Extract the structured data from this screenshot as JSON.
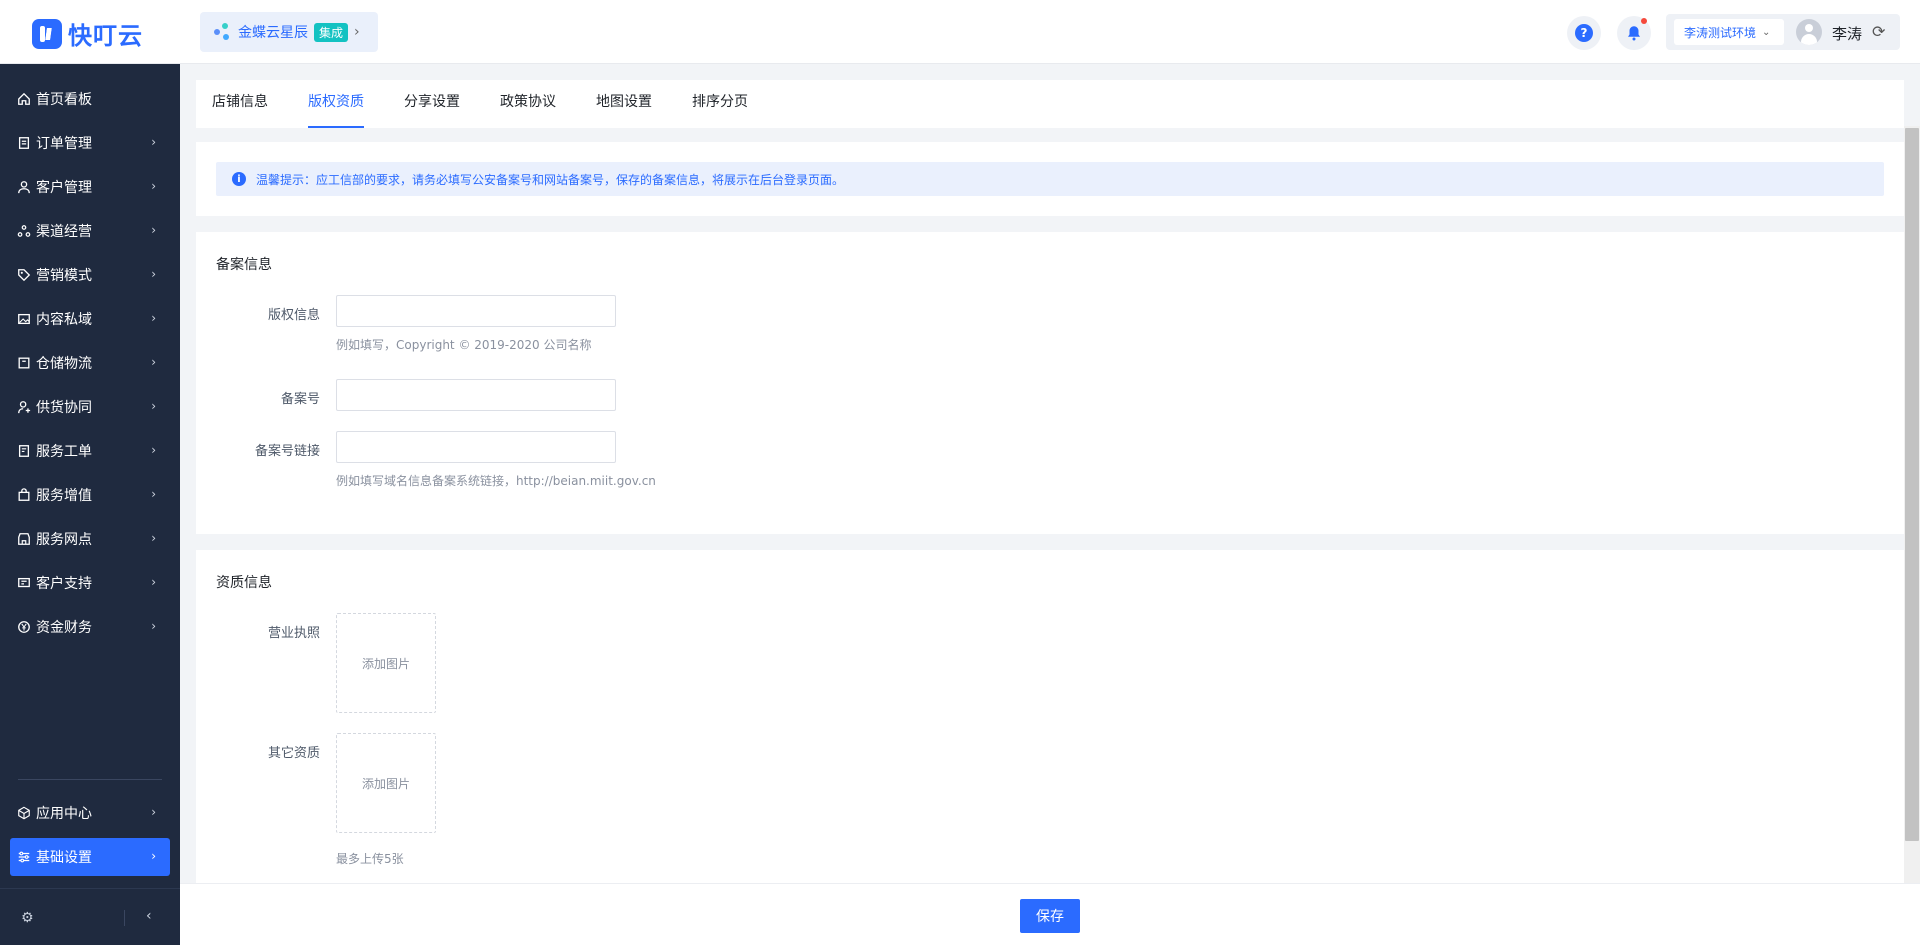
{
  "header": {
    "logo_text": "快叮云",
    "app_name": "金蝶云星辰",
    "app_badge": "集成",
    "help_glyph": "?",
    "env_label": "李涛测试环境",
    "user_name": "李涛",
    "icons": [
      "help-icon",
      "bell-icon",
      "chevron-down-icon",
      "avatar",
      "refresh-icon"
    ]
  },
  "sidebar": {
    "items": [
      {
        "label": "首页看板",
        "icon": "home-icon",
        "has_chevron": false
      },
      {
        "label": "订单管理",
        "icon": "order-icon",
        "has_chevron": true
      },
      {
        "label": "客户管理",
        "icon": "user-icon",
        "has_chevron": true
      },
      {
        "label": "渠道经营",
        "icon": "channel-icon",
        "has_chevron": true
      },
      {
        "label": "营销模式",
        "icon": "tag-icon",
        "has_chevron": true
      },
      {
        "label": "内容私域",
        "icon": "image-icon",
        "has_chevron": true
      },
      {
        "label": "仓储物流",
        "icon": "box-icon",
        "has_chevron": true
      },
      {
        "label": "供货协同",
        "icon": "supply-icon",
        "has_chevron": true
      },
      {
        "label": "服务工单",
        "icon": "ticket-icon",
        "has_chevron": true
      },
      {
        "label": "服务增值",
        "icon": "bag-icon",
        "has_chevron": true
      },
      {
        "label": "服务网点",
        "icon": "store-icon",
        "has_chevron": true
      },
      {
        "label": "客户支持",
        "icon": "support-icon",
        "has_chevron": true
      },
      {
        "label": "资金财务",
        "icon": "yuan-icon",
        "has_chevron": true
      }
    ],
    "bottom_items": [
      {
        "label": "应用中心",
        "icon": "cube-icon",
        "active": false
      },
      {
        "label": "基础设置",
        "icon": "settings-list-icon",
        "active": true
      }
    ]
  },
  "tabs": [
    {
      "label": "店铺信息",
      "active": false
    },
    {
      "label": "版权资质",
      "active": true
    },
    {
      "label": "分享设置",
      "active": false
    },
    {
      "label": "政策协议",
      "active": false
    },
    {
      "label": "地图设置",
      "active": false
    },
    {
      "label": "排序分页",
      "active": false
    }
  ],
  "notice": {
    "icon_glyph": "i",
    "text": "温馨提示：应工信部的要求，请务必填写公安备案号和网站备案号，保存的备案信息，将展示在后台登录页面。"
  },
  "record_section": {
    "title": "备案信息",
    "copyright_label": "版权信息",
    "copyright_value": "",
    "copyright_hint": "例如填写，Copyright © 2019-2020 公司名称",
    "record_no_label": "备案号",
    "record_no_value": "",
    "record_link_label": "备案号链接",
    "record_link_value": "",
    "record_link_hint": "例如填写域名信息备案系统链接，http://beian.miit.gov.cn"
  },
  "qualification_section": {
    "title": "资质信息",
    "license_label": "营业执照",
    "license_upload": "添加图片",
    "other_label": "其它资质",
    "other_upload": "添加图片",
    "limit_hint": "最多上传5张"
  },
  "footer": {
    "save_label": "保存"
  },
  "colors": {
    "primary": "#2b6bff",
    "sidebar_bg": "#1f2a3f",
    "notice_bg": "#eaf0fd",
    "badge": "#13c2c2",
    "alert_dot": "#f5483b"
  }
}
